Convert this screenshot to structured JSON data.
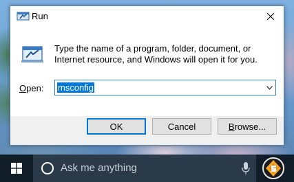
{
  "window": {
    "title": "Run",
    "description": "Type the name of a program, folder, document, or Internet resource, and Windows will open it for you.",
    "open_label_first": "O",
    "open_label_rest": "pen:",
    "open_value": "msconfig"
  },
  "buttons": {
    "ok": "OK",
    "cancel": "Cancel",
    "browse_first": "B",
    "browse_rest": "rowse..."
  },
  "taskbar": {
    "search_placeholder": "Ask me anything"
  },
  "icons": [
    "run-icon",
    "close-icon",
    "chevron-down-icon",
    "windows-start-icon",
    "cortana-icon",
    "microphone-icon",
    "app-icon"
  ],
  "colors": {
    "accent": "#0078d7",
    "taskbar": "#101c28",
    "search_box": "#2b3a48"
  }
}
